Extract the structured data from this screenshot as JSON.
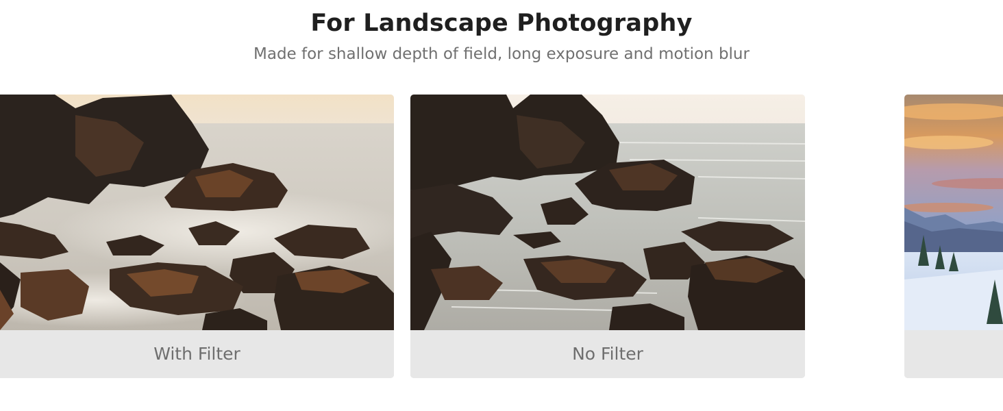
{
  "header": {
    "title": "For Landscape Photography",
    "subtitle": "Made for shallow depth of field, long exposure and motion blur"
  },
  "carousel": {
    "slides": [
      {
        "label": "With Filter",
        "photo": "long-exposure-rocky-seascape"
      },
      {
        "label": "No Filter",
        "photo": "rocky-seascape"
      },
      {
        "label": "",
        "photo": "snowy-mountain-sunset"
      }
    ]
  }
}
